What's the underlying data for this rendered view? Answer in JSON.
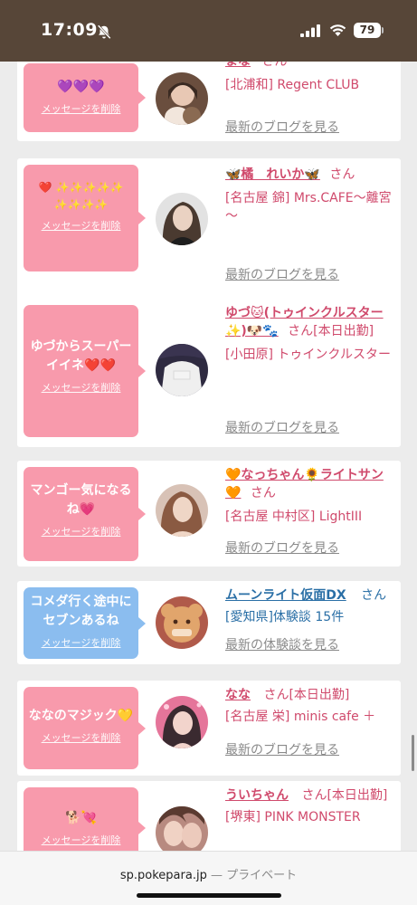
{
  "status_bar": {
    "time": "17:09",
    "battery": "79"
  },
  "cards": [
    {
      "message": "💜💜💜",
      "delete_label": "メッセージを削除",
      "name": "まな",
      "san": "さん",
      "shop": "[北浦和] Regent CLUB",
      "link": "最新のブログを見る"
    },
    {
      "message": "❤️ ✨✨✨✨✨ ✨✨✨✨",
      "delete_label": "メッセージを削除",
      "name": "🦋橘　れいか🦋",
      "san": "さん",
      "shop": "[名古屋 錦] Mrs.CAFE～離宮～",
      "link": "最新のブログを見る"
    },
    {
      "message": "ゆづからスーパーイイネ❤️❤️",
      "delete_label": "メッセージを削除",
      "name": "ゆづ🐱(トゥインクルスター✨)🐶🐾",
      "san": "さん[本日出勤]",
      "shop": "[小田原] トゥインクルスター",
      "link": "最新のブログを見る"
    },
    {
      "message": "マンゴー気になるね💗",
      "delete_label": "メッセージを削除",
      "name": "🧡なっちゃん🌻ライトサン🧡",
      "san": "さん",
      "shop": "[名古屋 中村区] LightIII",
      "link": "最新のブログを見る"
    },
    {
      "message": "コメダ行く途中にセブンあるね",
      "delete_label": "メッセージを削除",
      "name": "ムーンライト仮面DX",
      "san": "さん",
      "shop": "[愛知県]体験談 15件",
      "link": "最新の体験談を見る"
    },
    {
      "message": "ななのマジック💛",
      "delete_label": "メッセージを削除",
      "name": "なな",
      "san": "さん[本日出勤]",
      "shop": "[名古屋 栄] minis cafe ＋",
      "link": "最新のブログを見る"
    },
    {
      "message": "🐕💘",
      "delete_label": "メッセージを削除",
      "name": "ういちゃん",
      "san": "さん[本日出勤]",
      "shop": "[堺東] PINK MONSTER",
      "link": ""
    }
  ],
  "address_bar": {
    "domain": "sp.pokepara.jp",
    "separator": "—",
    "mode": "プライベート"
  },
  "colors": {
    "status_bg": "#574638",
    "bubble_pink": "#f89aac",
    "bubble_blue": "#8bbdef",
    "name_pink": "#d04a6c",
    "name_blue": "#2a6fa6"
  }
}
